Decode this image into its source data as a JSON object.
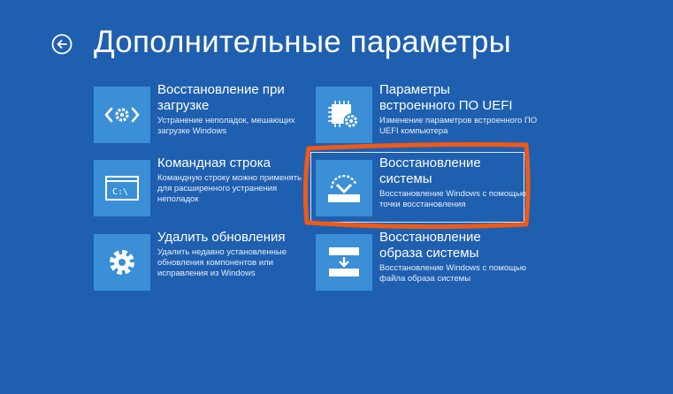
{
  "page": {
    "title": "Дополнительные параметры",
    "back_icon": "back-arrow-icon"
  },
  "colors": {
    "background": "#1f5fb0",
    "tile_icon_bg": "#3a8fd6",
    "highlight_ring": "#f05a14",
    "selected_frame": "#d8e6f7"
  },
  "tiles": [
    {
      "title": "Восстановление при\nзагрузке",
      "description": "Устранение неполадок, мешающих загрузке Windows",
      "icon": "startup-repair-icon"
    },
    {
      "title": "Параметры\nвстроенного ПО UEFI",
      "description": "Изменение параметров встроенного ПО UEFI компьютера",
      "icon": "uefi-chip-gear-icon"
    },
    {
      "title": "Командная строка",
      "description": "Командную строку можно применять для расширенного устранения неполадок",
      "icon": "command-prompt-icon",
      "icon_text": "C:\\"
    },
    {
      "title": "Восстановление\nсистемы",
      "description": "Восстановление Windows с помощью точки восстановления",
      "icon": "system-restore-icon",
      "selected": true
    },
    {
      "title": "Удалить обновления",
      "description": "Удалить недавно установленные обновления компонентов или исправления из Windows",
      "icon": "gear-icon"
    },
    {
      "title": "Восстановление\nобраза системы",
      "description": "Восстановление Windows с помощью файла образа системы",
      "icon": "system-image-recovery-icon"
    }
  ]
}
